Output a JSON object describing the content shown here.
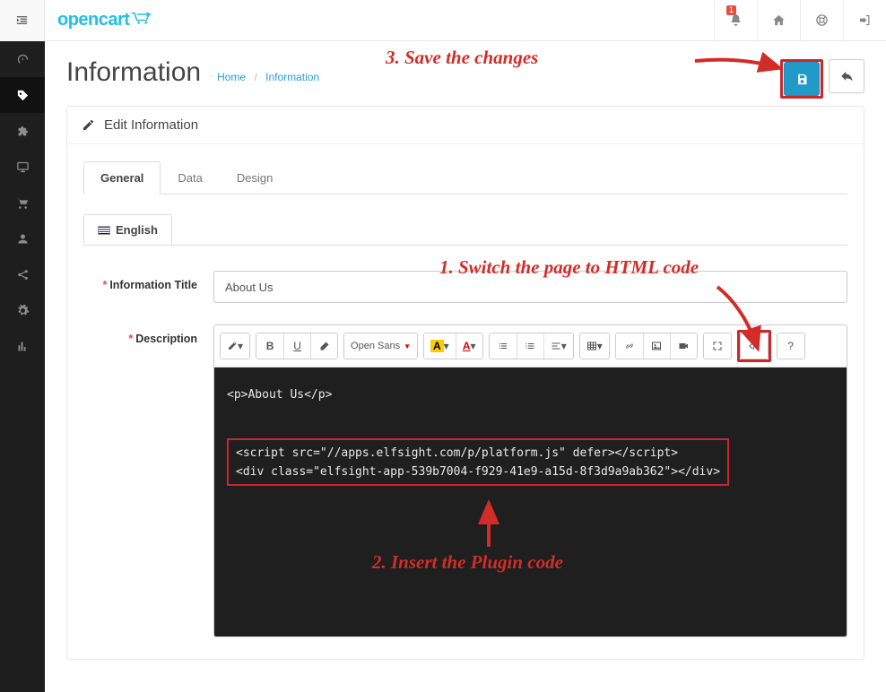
{
  "header": {
    "logo": "opencart",
    "notification_count": "1"
  },
  "page": {
    "title": "Information",
    "breadcrumb": {
      "home": "Home",
      "current": "Information"
    }
  },
  "panel": {
    "title": "Edit Information"
  },
  "tabs": {
    "general": "General",
    "data": "Data",
    "design": "Design"
  },
  "lang": {
    "english": "English"
  },
  "form": {
    "title_label": "Information Title",
    "title_value": "About Us",
    "description_label": "Description",
    "font_family": "Open Sans"
  },
  "editor": {
    "line1": "<p>About Us</p>",
    "line2": "<script src=\"//apps.elfsight.com/p/platform.js\" defer></script>",
    "line3": "<div class=\"elfsight-app-539b7004-f929-41e9-a15d-8f3d9a9ab362\"></div>"
  },
  "annotations": {
    "a1": "1. Switch the page to HTML code",
    "a2": "2. Insert the Plugin code",
    "a3": "3. Save the changes"
  }
}
